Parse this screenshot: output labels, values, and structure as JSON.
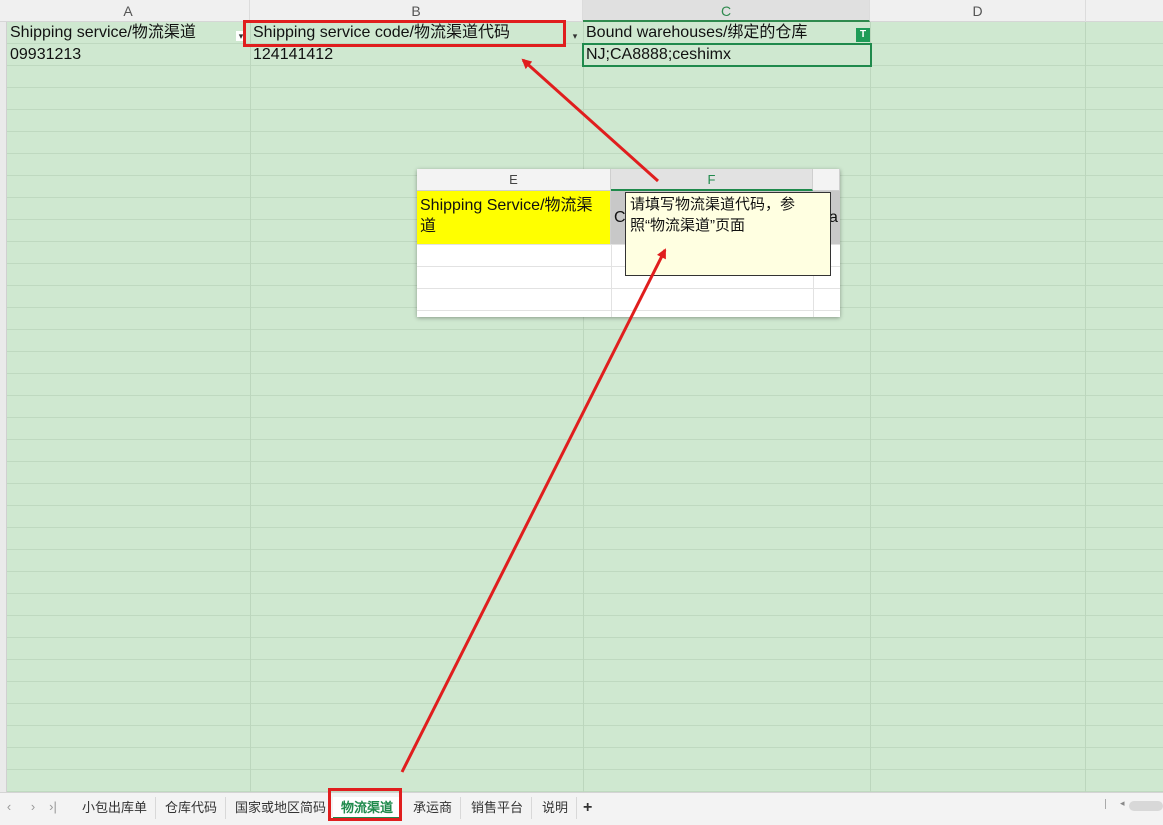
{
  "columns": [
    "A",
    "B",
    "C",
    "D"
  ],
  "header_row": {
    "a": "Shipping service/物流渠道",
    "b": "Shipping service code/物流渠道代码",
    "c": "Bound warehouses/绑定的仓库"
  },
  "data_row": {
    "a": "09931213",
    "b": "124141412",
    "c": "NJ;CA8888;ceshimx"
  },
  "filter_icon": "dropdown-arrow-icon",
  "text_badge": "T",
  "inset": {
    "columns": [
      "E",
      "F"
    ],
    "yellow_header": "Shipping Service/物流渠道",
    "grey_fragment_left": "C",
    "grey_fragment_right": "a",
    "comment_text": "请填写物流渠道代码，参照“物流渠道”页面"
  },
  "tabs": [
    "小包出库单",
    "仓库代码",
    "国家或地区简码",
    "物流渠道",
    "承运商",
    "销售平台",
    "说明"
  ],
  "active_tab": "物流渠道",
  "nav_icons": [
    "prev-sheet-icon",
    "next-sheet-icon",
    "last-sheet-icon"
  ],
  "add_tab": "+",
  "colors": {
    "sheet_bg": "#cfe8d0",
    "annotation": "#e01e1e",
    "accent": "#1f8a4c",
    "highlight": "#ffff00"
  }
}
